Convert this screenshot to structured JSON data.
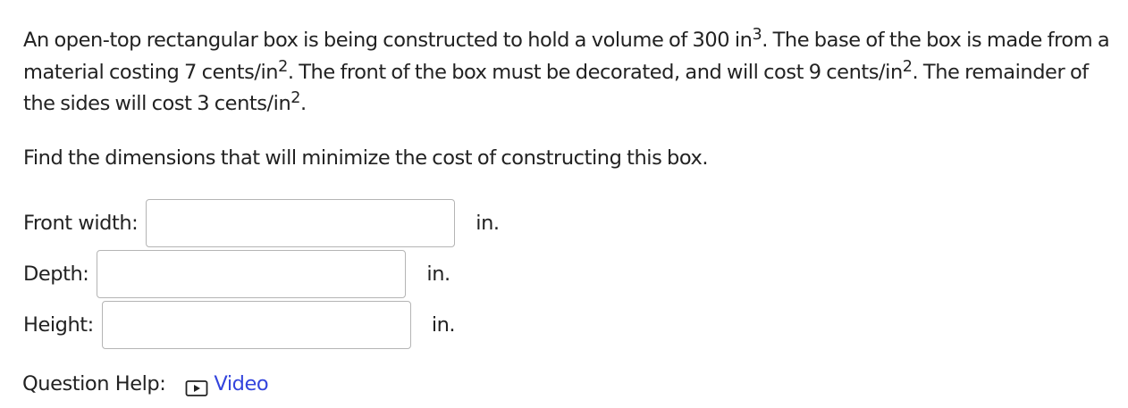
{
  "question": {
    "sentence1_before": "An open-top rectangular box is being constructed to hold a volume of 300 in",
    "sentence1_exp": "3",
    "sentence1_after": ". The base of the box is made from a material costing 7 cents/in",
    "sentence2_exp": "2",
    "sentence2_after": ". The front of the box must be decorated, and will cost 9 cents/in",
    "sentence3_exp": "2",
    "sentence3_after": ". The remainder of the sides will cost 3 cents/in",
    "sentence4_exp": "2",
    "sentence4_after": ".",
    "instruction": "Find the dimensions that will minimize the cost of constructing this box."
  },
  "fields": {
    "front": {
      "label": "Front width:",
      "value": "",
      "unit": "in."
    },
    "depth": {
      "label": "Depth:",
      "value": "",
      "unit": "in."
    },
    "height": {
      "label": "Height:",
      "value": "",
      "unit": "in."
    }
  },
  "help": {
    "label": "Question Help:",
    "video_label": "Video",
    "link_color": "#3344dd",
    "video_icon": "play-icon"
  }
}
